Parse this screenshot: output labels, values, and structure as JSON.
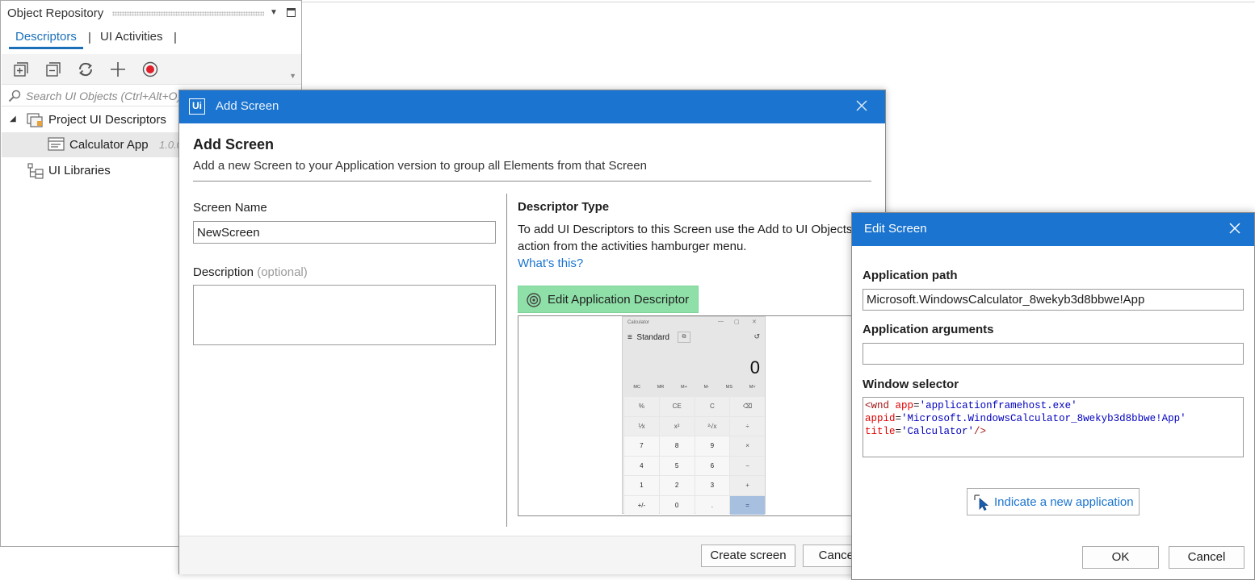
{
  "colors": {
    "titlebar_blue": "#1a74d0",
    "tab_accent": "#1a6fb8",
    "green_button": "#8fe0a8",
    "link_blue": "#1a74d0"
  },
  "repository": {
    "title": "Object Repository",
    "tabs": [
      {
        "label": "Descriptors",
        "active": true
      },
      {
        "label": "UI Activities",
        "active": false
      }
    ],
    "tab_separator": "|",
    "toolbar_icons": [
      "expand-all-icon",
      "collapse-all-icon",
      "refresh-icon",
      "add-icon",
      "record-icon"
    ],
    "search_placeholder": "Search UI Objects (Ctrl+Alt+O)",
    "tree": {
      "project_descriptors": "Project UI Descriptors",
      "calculator_app": "Calculator App",
      "calculator_version": "1.0.0",
      "ui_libraries": "UI Libraries"
    }
  },
  "add_screen": {
    "title": "Add Screen",
    "heading": "Add Screen",
    "subheading": "Add a new Screen to your Application version to group all Elements from that Screen",
    "screen_name_label": "Screen Name",
    "screen_name_value": "NewScreen",
    "description_label": "Description",
    "description_optional": "(optional)",
    "description_value": "",
    "descriptor_type_title": "Descriptor Type",
    "descriptor_type_text": "To add UI Descriptors to this Screen use the Add to UI Objects action from the activities hamburger menu.",
    "whats_this": "What's this?",
    "edit_descriptor_label": "Edit Application Descriptor",
    "create_button": "Create screen",
    "cancel_button": "Cancel",
    "preview_calculator": {
      "title": "Calculator",
      "mode": "Standard",
      "display": "0",
      "memory_keys": [
        "MC",
        "MR",
        "M+",
        "M-",
        "MS",
        "M˅"
      ],
      "keys": [
        "%",
        "CE",
        "C",
        "⌫",
        "⅟x",
        "x²",
        "²√x",
        "÷",
        "7",
        "8",
        "9",
        "×",
        "4",
        "5",
        "6",
        "−",
        "1",
        "2",
        "3",
        "+",
        "+/-",
        "0",
        ".",
        "="
      ]
    }
  },
  "edit_screen": {
    "title": "Edit Screen",
    "app_path_label": "Application path",
    "app_path_value": "Microsoft.WindowsCalculator_8wekyb3d8bbwe!App",
    "app_args_label": "Application arguments",
    "app_args_value": "",
    "window_selector_label": "Window selector",
    "selector": {
      "open": "<wnd",
      "attr1": "app",
      "val1": "'applicationframehost.exe'",
      "attr2": "appid",
      "val2": "'Microsoft.WindowsCalculator_8wekyb3d8bbwe!App'",
      "attr3": "title",
      "val3": "'Calculator'",
      "close": "/>"
    },
    "indicate_label": "Indicate a new application",
    "ok_button": "OK",
    "cancel_button": "Cancel"
  }
}
